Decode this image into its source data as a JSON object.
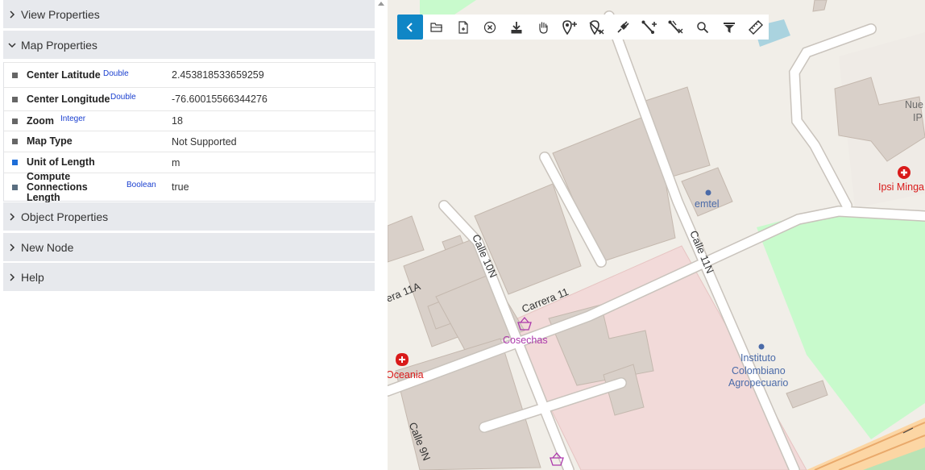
{
  "sidebar": {
    "sections": [
      {
        "label": "View Properties",
        "expanded": false
      },
      {
        "label": "Map Properties",
        "expanded": true
      },
      {
        "label": "Object Properties",
        "expanded": false
      },
      {
        "label": "New Node",
        "expanded": false
      },
      {
        "label": "Help",
        "expanded": false
      }
    ],
    "map_properties": [
      {
        "name": "Center Latitude",
        "type": "Double",
        "value": "2.453818533659259"
      },
      {
        "name": "Center Longitude",
        "type": "Double",
        "value": "-76.60015566344276"
      },
      {
        "name": "Zoom",
        "type": "Integer",
        "value": "18"
      },
      {
        "name": "Map Type",
        "type": "",
        "value": "Not Supported"
      },
      {
        "name": "Unit of Length",
        "type": "",
        "value": "m"
      },
      {
        "name": "Compute Connections Length",
        "type": "Boolean",
        "value": "true"
      }
    ]
  },
  "toolbar": {
    "buttons": [
      {
        "name": "collapse-panel",
        "icon": "chevron-left-icon"
      },
      {
        "name": "open",
        "icon": "folder-icon"
      },
      {
        "name": "new-file",
        "icon": "file-plus-icon"
      },
      {
        "name": "close",
        "icon": "circle-x-icon"
      },
      {
        "name": "download",
        "icon": "download-icon"
      },
      {
        "name": "pan",
        "icon": "hand-icon"
      },
      {
        "name": "add-marker",
        "icon": "marker-plus-icon"
      },
      {
        "name": "remove-marker",
        "icon": "marker-off-icon"
      },
      {
        "name": "connect",
        "icon": "plug-icon"
      },
      {
        "name": "add-connection",
        "icon": "line-plus-icon"
      },
      {
        "name": "remove-connection",
        "icon": "line-off-icon"
      },
      {
        "name": "search",
        "icon": "search-icon"
      },
      {
        "name": "filter",
        "icon": "filter-icon"
      },
      {
        "name": "measure",
        "icon": "ruler-icon"
      }
    ],
    "accent": "#0f86c6"
  },
  "map": {
    "labels": {
      "calle_10n": "Calle 10N",
      "calle_11n": "Calle 11N",
      "calle_9n": "Calle 9N",
      "carrera_11": "Carrera 11",
      "carrera_11a": "era 11A",
      "emtel": "emtel",
      "cosechas": "Cosechas",
      "oceania": "Oceania",
      "instituto": "Instituto",
      "colombiano": "Colombiano",
      "agropecuario": "Agropecuario",
      "ipsi_minga": "Ipsi Minga",
      "nue": "Nue",
      "ip": "IP"
    },
    "colors": {
      "land": "#f1eee8",
      "building": "#d9d0c9",
      "commercial": "#f2dad9",
      "park": "#c8facc",
      "road": "#ffffff",
      "health": "#d91a1a",
      "shop": "#ac39ac",
      "poi": "#4a6aa8"
    }
  }
}
